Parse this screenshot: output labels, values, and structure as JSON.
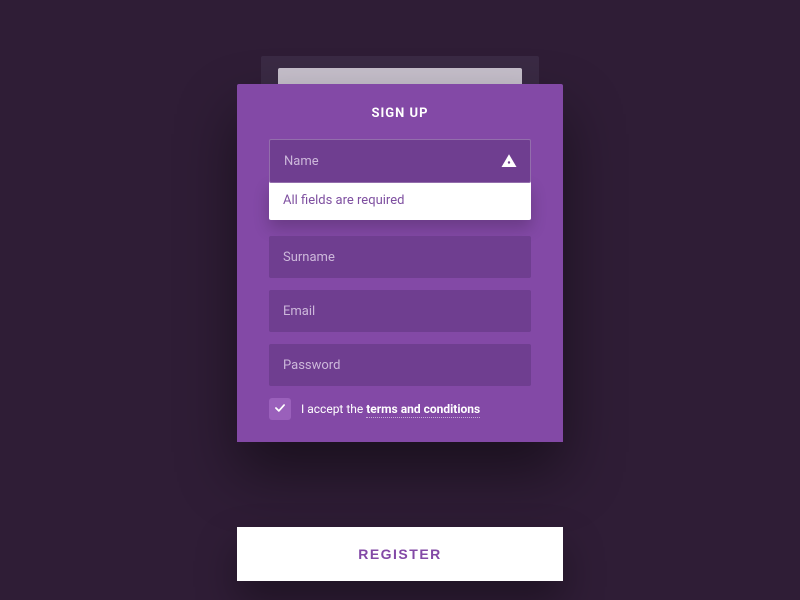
{
  "colors": {
    "background": "#2f1d36",
    "modal": "#8349a6",
    "field": "#6f3e90",
    "accent": "#9a60bb",
    "text_light": "#ffffff",
    "text_purple": "#7e4fa0"
  },
  "form": {
    "title": "SIGN UP",
    "fields": {
      "name": {
        "placeholder": "Name",
        "value": "",
        "error": true
      },
      "surname": {
        "placeholder": "Surname",
        "value": ""
      },
      "email": {
        "placeholder": "Email",
        "value": ""
      },
      "password": {
        "placeholder": "Password",
        "value": ""
      }
    },
    "error_message": "All fields are required",
    "terms": {
      "checked": true,
      "prefix": "I accept the ",
      "link": "terms and conditions"
    },
    "submit_label": "REGISTER"
  }
}
